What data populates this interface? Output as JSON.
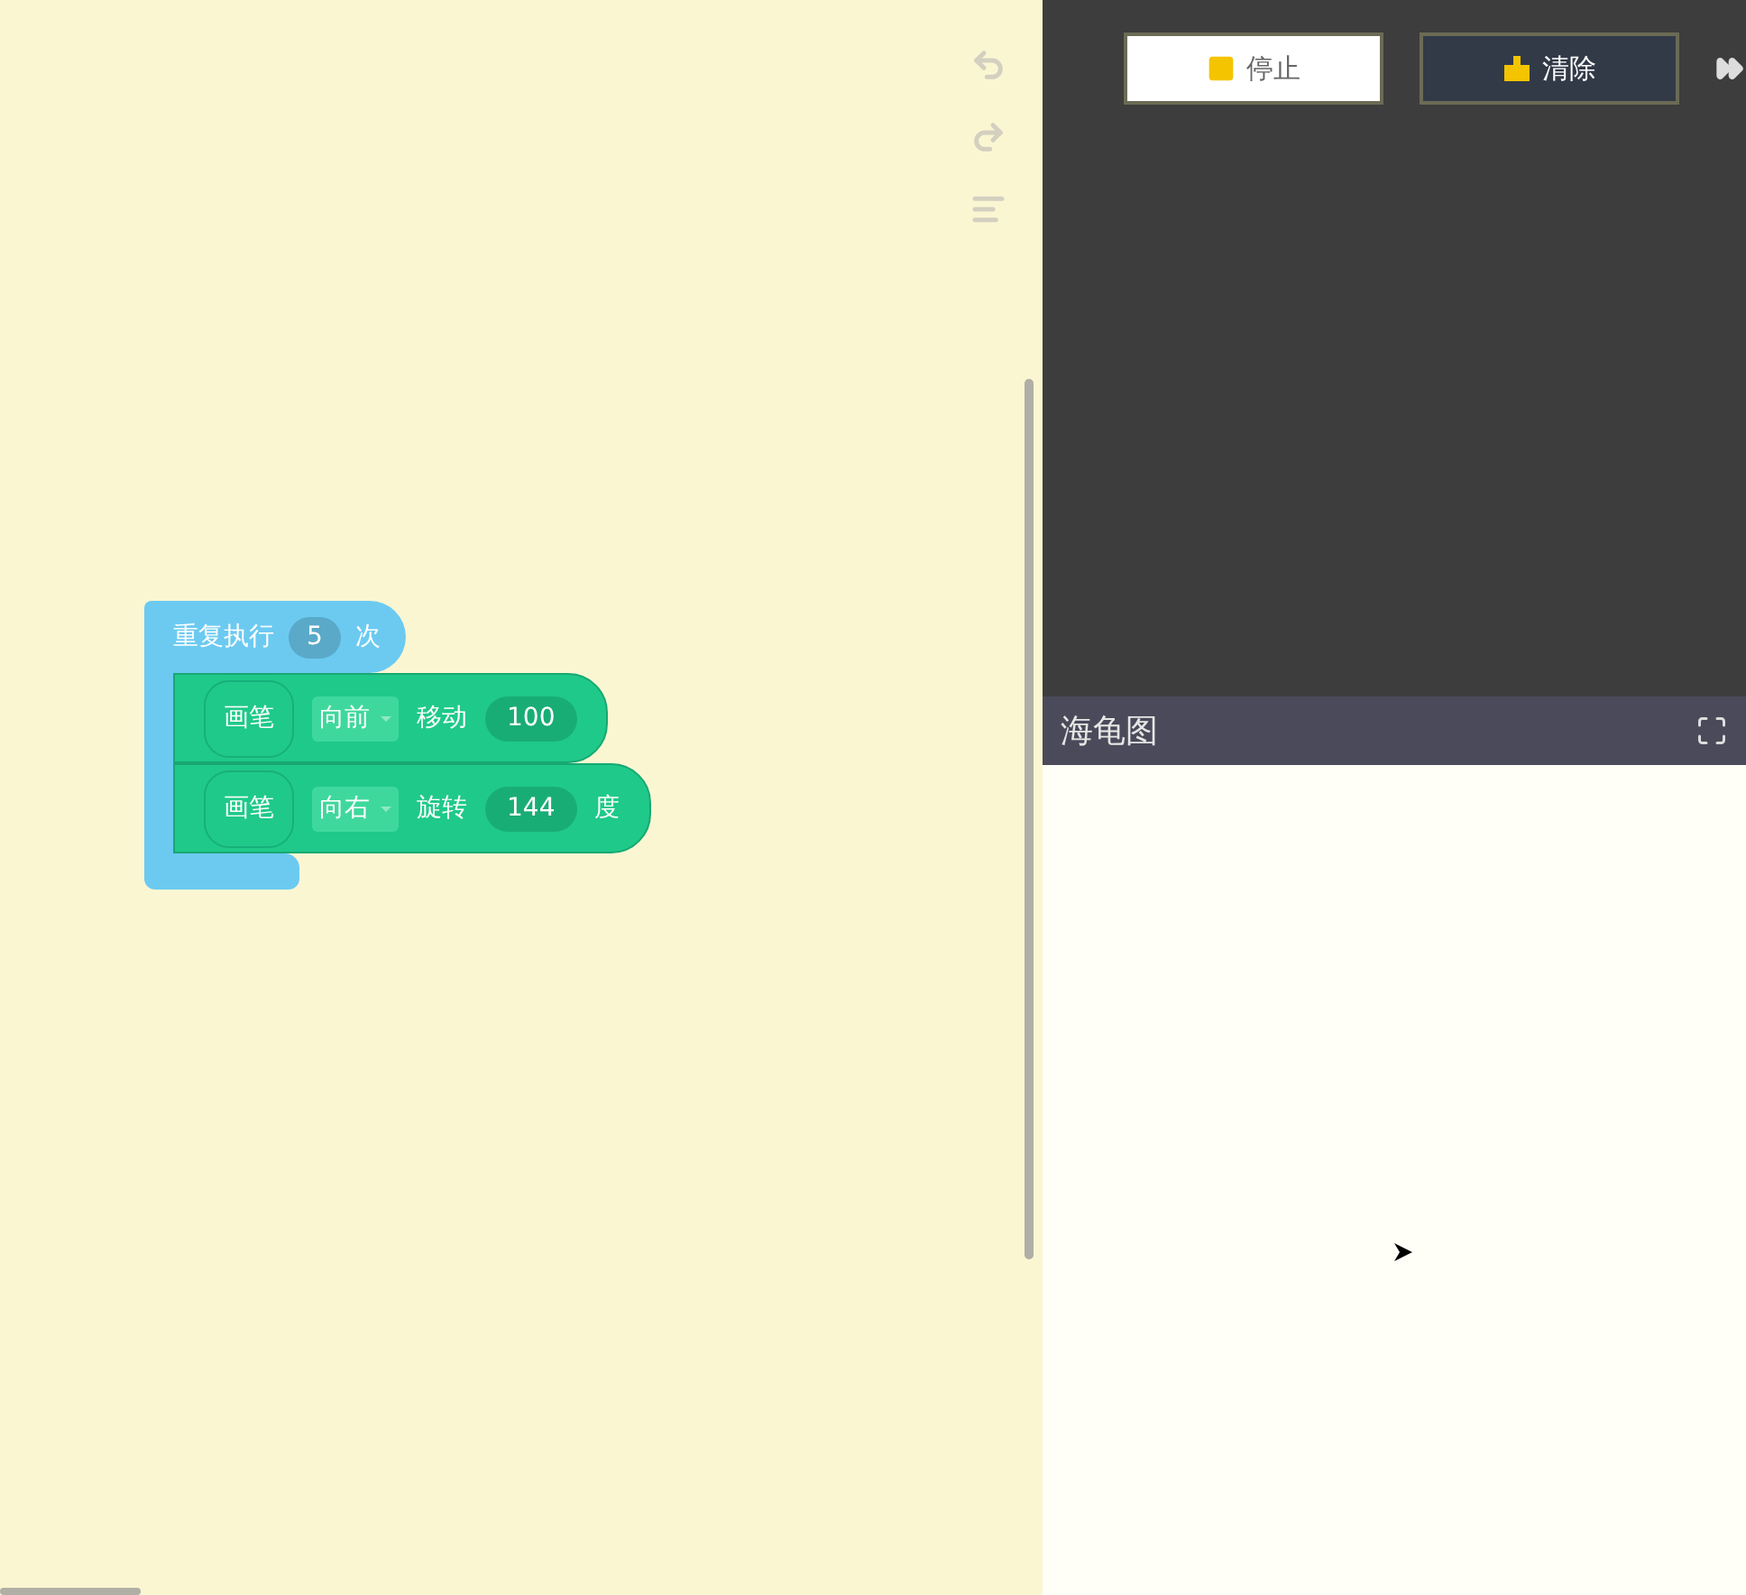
{
  "repeat_block": {
    "label": "重复执行",
    "count": "5",
    "unit": "次",
    "children": [
      {
        "pen": "画笔",
        "direction": "向前",
        "action": "移动",
        "value": "100"
      },
      {
        "pen": "画笔",
        "direction": "向右",
        "action": "旋转",
        "value": "144",
        "unit": "度"
      }
    ]
  },
  "toolbar": {
    "stop_button": "停止",
    "clear_button": "清除"
  },
  "turtle_panel": {
    "title": "海龟图"
  }
}
